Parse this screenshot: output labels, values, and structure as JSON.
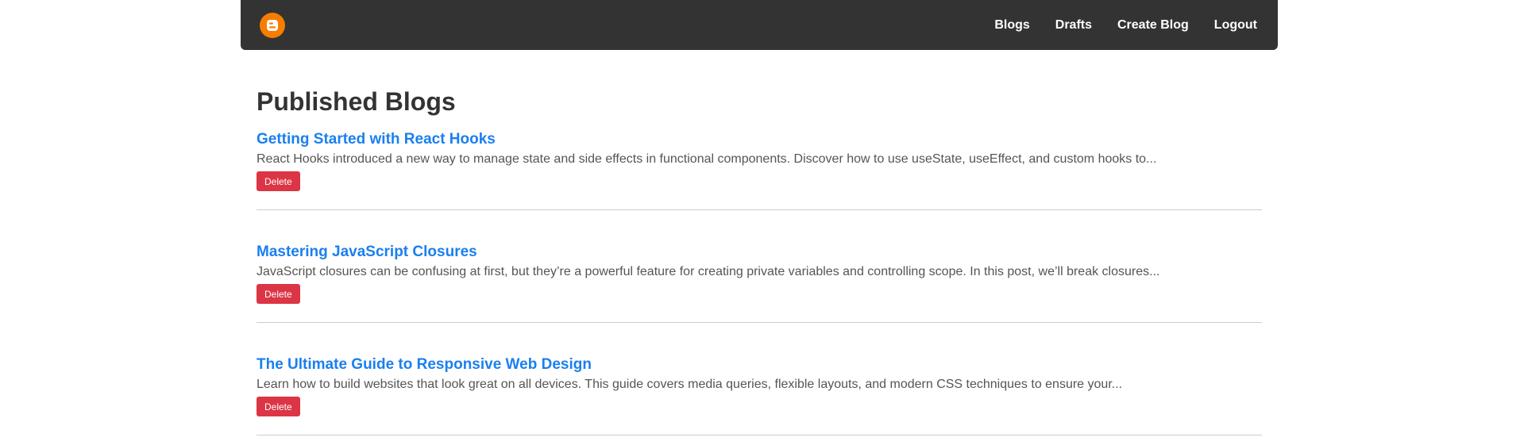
{
  "navbar": {
    "logo_icon": "blogger-icon",
    "brand_color": "#f57d00",
    "background_color": "#333333",
    "links": [
      {
        "label": "Blogs"
      },
      {
        "label": "Drafts"
      },
      {
        "label": "Create Blog"
      },
      {
        "label": "Logout"
      }
    ]
  },
  "main": {
    "title": "Published Blogs",
    "link_color": "#1a7ff0",
    "delete_color": "#dc3545",
    "blogs": [
      {
        "title": "Getting Started with React Hooks",
        "excerpt": "React Hooks introduced a new way to manage state and side effects in functional components. Discover how to use useState, useEffect, and custom hooks to...",
        "delete_label": "Delete"
      },
      {
        "title": "Mastering JavaScript Closures",
        "excerpt": "JavaScript closures can be confusing at first, but they’re a powerful feature for creating private variables and controlling scope. In this post, we’ll break closures...",
        "delete_label": "Delete"
      },
      {
        "title": "The Ultimate Guide to Responsive Web Design",
        "excerpt": "Learn how to build websites that look great on all devices. This guide covers media queries, flexible layouts, and modern CSS techniques to ensure your...",
        "delete_label": "Delete"
      }
    ]
  }
}
